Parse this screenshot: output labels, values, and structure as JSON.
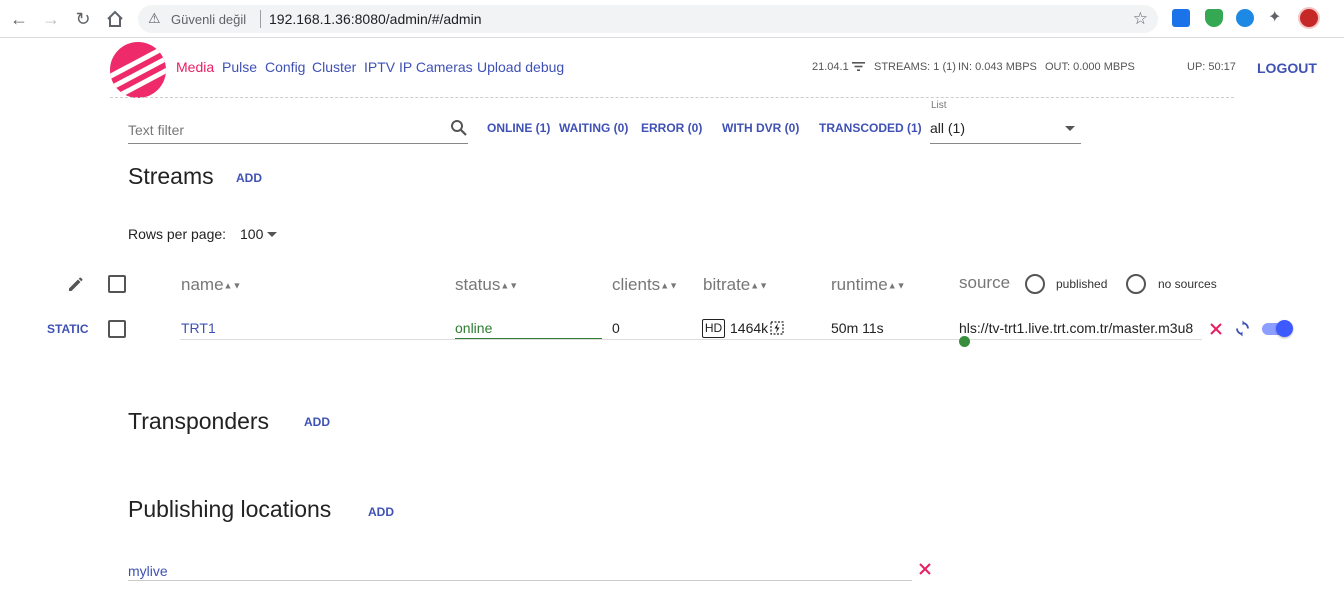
{
  "browser": {
    "security_label": "Güvenli değil",
    "url": "192.168.1.36:8080/admin/#/admin"
  },
  "nav": {
    "items": [
      "Media",
      "Pulse",
      "Config",
      "Cluster",
      "IPTV",
      "IP Cameras",
      "Upload debug"
    ],
    "active": "Media"
  },
  "stats": {
    "version": "21.04.1",
    "streams": "STREAMS: 1 (1)",
    "in": "IN: 0.043 MBPS",
    "out": "OUT: 0.000 MBPS",
    "up": "UP: 50:17"
  },
  "logout_label": "LOGOUT",
  "filter": {
    "placeholder": "Text filter",
    "chips": [
      "ONLINE (1)",
      "WAITING (0)",
      "ERROR (0)",
      "WITH DVR (0)",
      "TRANSCODED (1)"
    ],
    "list_label": "List",
    "list_value": "all (1)"
  },
  "streams": {
    "title": "Streams",
    "add_label": "ADD",
    "rows_per_page_label": "Rows per page:",
    "rows_per_page": "100",
    "columns": [
      "name",
      "status",
      "clients",
      "bitrate",
      "runtime",
      "source"
    ],
    "source_options": [
      "published",
      "no sources"
    ],
    "rows": [
      {
        "type": "STATIC",
        "name": "TRT1",
        "status": "online",
        "clients": "0",
        "quality": "HD",
        "bitrate": "1464k",
        "runtime": "50m 11s",
        "source": "hls://tv-trt1.live.trt.com.tr/master.m3u8",
        "enabled": true
      }
    ]
  },
  "transponders": {
    "title": "Transponders",
    "add_label": "ADD"
  },
  "publishing": {
    "title": "Publishing locations",
    "add_label": "ADD",
    "items": [
      "mylive"
    ]
  },
  "colors": {
    "primary": "#3f51b5",
    "accent": "#e91e63",
    "online": "#2e7d32",
    "logo": "#ee2a6a"
  }
}
